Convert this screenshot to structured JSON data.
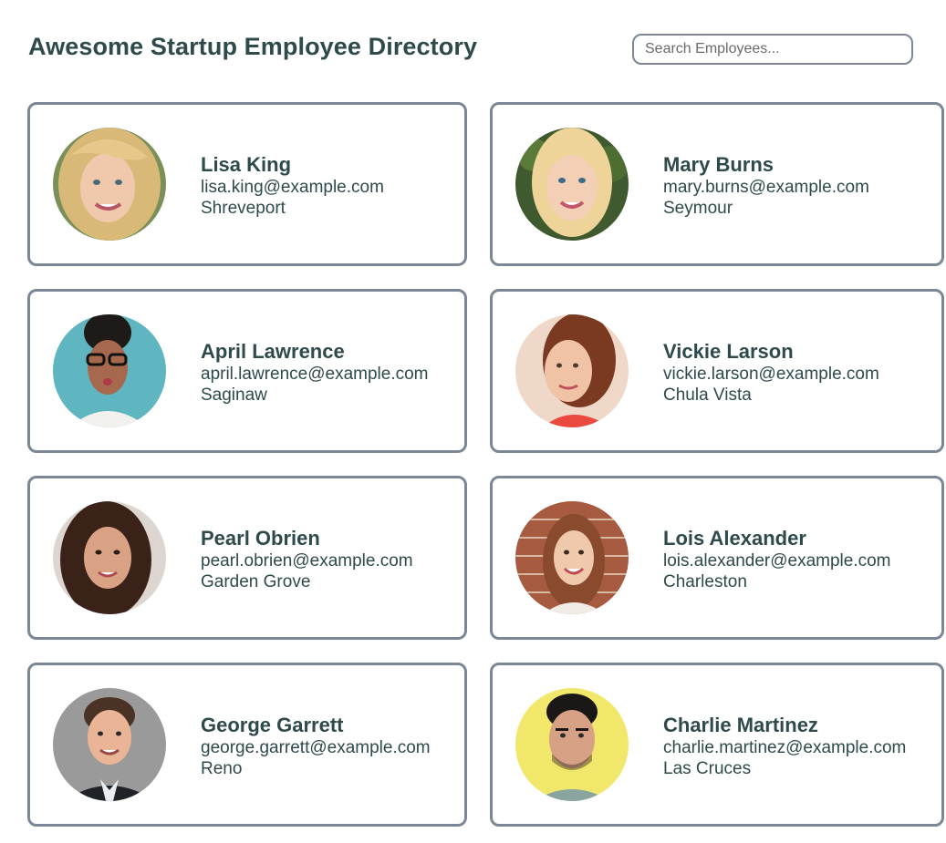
{
  "header": {
    "title": "Awesome Startup Employee Directory"
  },
  "search": {
    "placeholder": "Search Employees...",
    "value": ""
  },
  "employees": [
    {
      "name": "Lisa King",
      "email": "lisa.king@example.com",
      "city": "Shreveport",
      "icon": "woman-portrait-blonde-wavy"
    },
    {
      "name": "Mary Burns",
      "email": "mary.burns@example.com",
      "city": "Seymour",
      "icon": "woman-portrait-blonde-green-bg"
    },
    {
      "name": "April Lawrence",
      "email": "april.lawrence@example.com",
      "city": "Saginaw",
      "icon": "woman-portrait-glasses-teal-bg"
    },
    {
      "name": "Vickie Larson",
      "email": "vickie.larson@example.com",
      "city": "Chula Vista",
      "icon": "woman-portrait-auburn"
    },
    {
      "name": "Pearl Obrien",
      "email": "pearl.obrien@example.com",
      "city": "Garden Grove",
      "icon": "woman-portrait-dark-hair"
    },
    {
      "name": "Lois Alexander",
      "email": "lois.alexander@example.com",
      "city": "Charleston",
      "icon": "woman-portrait-brick-bg"
    },
    {
      "name": "George Garrett",
      "email": "george.garrett@example.com",
      "city": "Reno",
      "icon": "man-portrait-suit"
    },
    {
      "name": "Charlie Martinez",
      "email": "charlie.martinez@example.com",
      "city": "Las Cruces",
      "icon": "man-portrait-yellow-bg"
    }
  ],
  "colors": {
    "text": "#2e4a4b",
    "card_border": "#7b8794"
  }
}
